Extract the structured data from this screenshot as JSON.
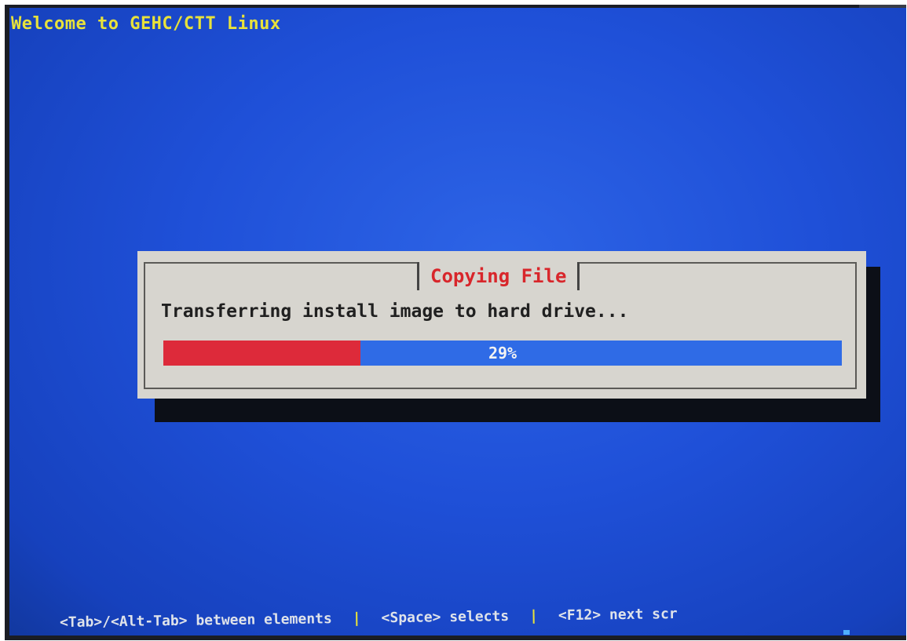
{
  "header": {
    "welcome_text": "Welcome to GEHC/CTT Linux"
  },
  "dialog": {
    "title": "Copying File",
    "message": "Transferring install image to hard drive...",
    "progress": {
      "percent": 29,
      "label": "29%"
    }
  },
  "help_bar": {
    "items": [
      "<Tab>/<Alt-Tab> between elements",
      "<Space> selects",
      "<F12> next scr"
    ],
    "separator": "|"
  },
  "colors": {
    "screen_bg": "#1f50d8",
    "welcome_text": "#e8e23a",
    "dialog_bg": "#d7d5cf",
    "dialog_title": "#d8262b",
    "progress_fill": "#dd2a3a",
    "progress_track": "#2f6be6"
  }
}
